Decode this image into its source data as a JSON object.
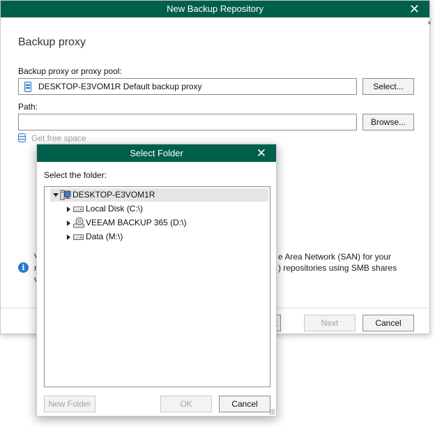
{
  "main_window": {
    "title": "New Backup Repository",
    "close_glyph": "✕",
    "section_title": "Backup proxy",
    "proxy_label": "Backup proxy or proxy pool:",
    "proxy_value": "DESKTOP-E3VOM1R Default backup proxy",
    "select_button": "Select...",
    "path_label": "Path:",
    "path_value": "",
    "browse_button": "Browse...",
    "free_space_link": "Get free space",
    "info_lines": {
      "left_1": "V",
      "left_2": "r",
      "left_3": "v",
      "right_1": "e Area Network (SAN) for your",
      "right_2": ") repositories using SMB shares"
    },
    "back_button_fragment": "k",
    "next_button": "Next",
    "cancel_button": "Cancel",
    "edge_mark": "×"
  },
  "dialog": {
    "title": "Select Folder",
    "close_glyph": "✕",
    "prompt": "Select the folder:",
    "tree": {
      "root": "DESKTOP-E3VOM1R",
      "children": [
        {
          "label": "Local Disk (C:\\)",
          "icon": "hard-disk-icon"
        },
        {
          "label": "VEEAM BACKUP 365 (D:\\)",
          "icon": "cd-drive-icon"
        },
        {
          "label": "Data (M:\\)",
          "icon": "hard-disk-icon"
        }
      ]
    },
    "new_folder_button": "New Folder",
    "ok_button": "OK",
    "cancel_button": "Cancel"
  },
  "colors": {
    "title_bar": "#005f4b",
    "accent_blue": "#2a7ad0"
  }
}
